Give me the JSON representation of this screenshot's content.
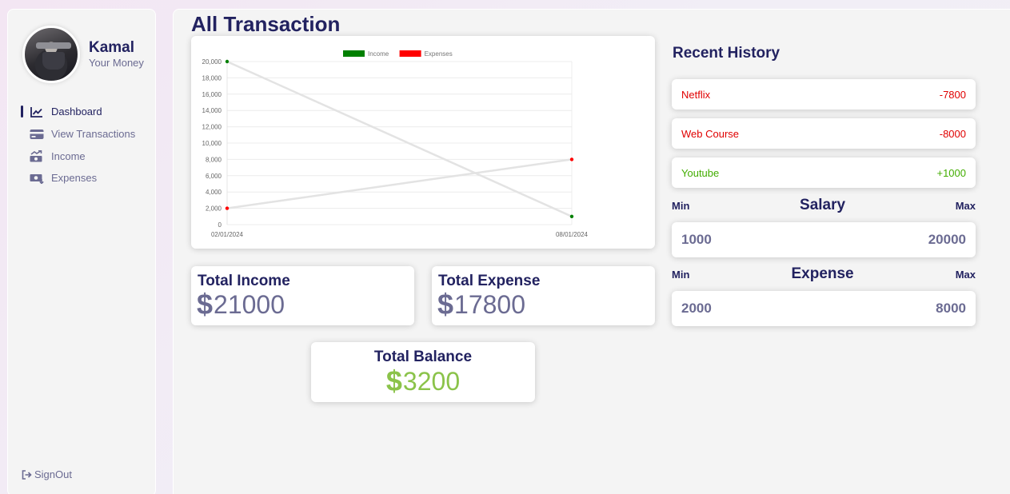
{
  "profile": {
    "name": "Kamal",
    "subtitle": "Your Money"
  },
  "nav": {
    "items": [
      {
        "label": "Dashboard",
        "icon": "chart-line-icon",
        "active": true
      },
      {
        "label": "View Transactions",
        "icon": "credit-card-icon",
        "active": false
      },
      {
        "label": "Income",
        "icon": "money-bill-trend-up-icon",
        "active": false
      },
      {
        "label": "Expenses",
        "icon": "money-bill-down-icon",
        "active": false
      }
    ],
    "signout": "SignOut"
  },
  "main": {
    "title": "All Transaction"
  },
  "stats": {
    "income_title": "Total Income",
    "income_value": "21000",
    "expense_title": "Total Expense",
    "expense_value": "17800",
    "balance_title": "Total Balance",
    "balance_value": "3200",
    "currency": "$"
  },
  "history": {
    "title": "Recent History",
    "items": [
      {
        "name": "Netflix",
        "amount": "-7800",
        "type": "expense"
      },
      {
        "name": "Web Course",
        "amount": "-8000",
        "type": "expense"
      },
      {
        "name": "Youtube",
        "amount": "+1000",
        "type": "income"
      }
    ]
  },
  "salary": {
    "title": "Salary",
    "min_label": "Min",
    "max_label": "Max",
    "min": "1000",
    "max": "20000"
  },
  "expense_range": {
    "title": "Expense",
    "min_label": "Min",
    "max_label": "Max",
    "min": "2000",
    "max": "8000"
  },
  "colors": {
    "income": "#008000",
    "expense": "#ff0000",
    "income_text": "#42ad00",
    "expense_text": "#e00000",
    "accent": "#222260",
    "balance": "#8bc34a"
  },
  "chart_data": {
    "type": "line",
    "categories": [
      "02/01/2024",
      "08/01/2024"
    ],
    "series": [
      {
        "name": "Income",
        "values": [
          20000,
          1000
        ],
        "color": "#008000"
      },
      {
        "name": "Expenses",
        "values": [
          2000,
          8000
        ],
        "color": "#ff0000"
      }
    ],
    "ylim": [
      0,
      20000
    ],
    "yticks": [
      "0",
      "2,000",
      "4,000",
      "6,000",
      "8,000",
      "10,000",
      "12,000",
      "14,000",
      "16,000",
      "18,000",
      "20,000"
    ],
    "grid": true,
    "legend": "top"
  }
}
